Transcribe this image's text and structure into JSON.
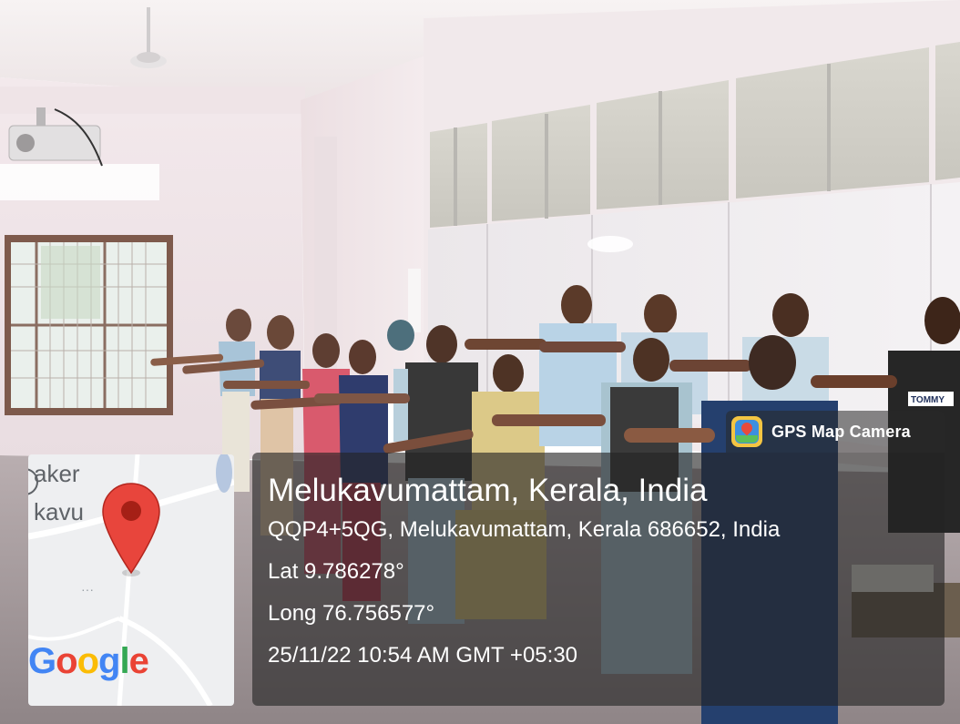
{
  "photo": {
    "icon": "gps-map-camera-icon",
    "badge_label": "GPS Map Camera"
  },
  "location": {
    "title": "Melukavumattam, Kerala, India",
    "address": "QQP4+5QG, Melukavumattam, Kerala 686652, India",
    "latitude": "Lat 9.786278°",
    "longitude": "Long 76.756577°",
    "timestamp": "25/11/22 10:54 AM GMT +05:30"
  },
  "map": {
    "label_line1": "aker",
    "label_line2": "kavu",
    "marker_icon": "map-pin-icon",
    "marker_color": "#e8453c",
    "logo": "Google",
    "logo_colors": [
      "#4285f4",
      "#ea4335",
      "#fbbc05",
      "#4285f4",
      "#34a853",
      "#ea4335"
    ]
  },
  "people_shirt": "TOMMY"
}
